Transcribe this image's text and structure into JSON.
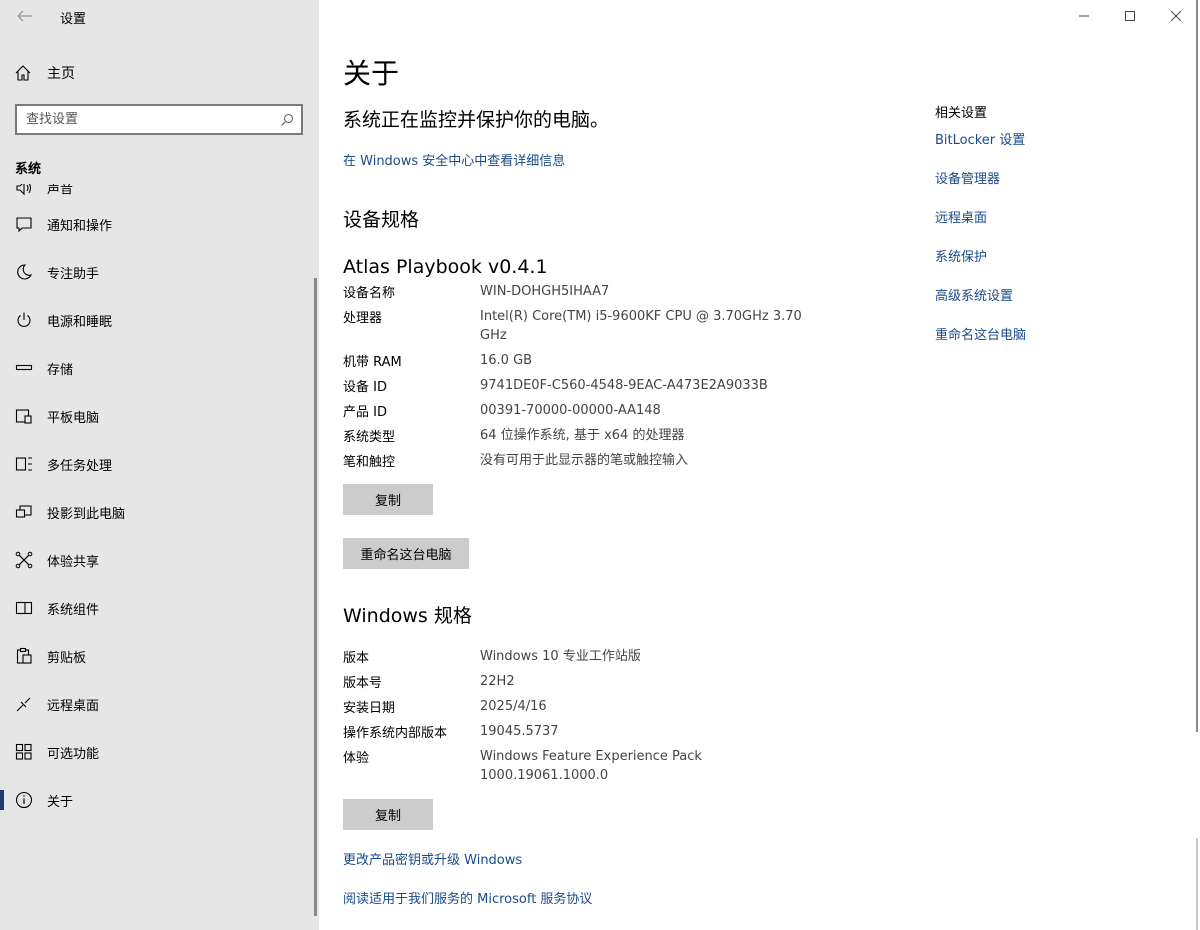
{
  "window": {
    "app_title": "设置",
    "controls": {
      "minimize": "—",
      "maximize": "☐",
      "close": "✕"
    }
  },
  "sidebar": {
    "home_label": "主页",
    "search_placeholder": "查找设置",
    "section_label": "系统",
    "items": [
      {
        "label": "声音",
        "icon": "speaker-icon"
      },
      {
        "label": "通知和操作",
        "icon": "message-icon"
      },
      {
        "label": "专注助手",
        "icon": "moon-icon"
      },
      {
        "label": "电源和睡眠",
        "icon": "power-icon"
      },
      {
        "label": "存储",
        "icon": "storage-icon"
      },
      {
        "label": "平板电脑",
        "icon": "tablet-icon"
      },
      {
        "label": "多任务处理",
        "icon": "multitask-icon"
      },
      {
        "label": "投影到此电脑",
        "icon": "project-icon"
      },
      {
        "label": "体验共享",
        "icon": "share-icon"
      },
      {
        "label": "系统组件",
        "icon": "components-icon"
      },
      {
        "label": "剪贴板",
        "icon": "clipboard-icon"
      },
      {
        "label": "远程桌面",
        "icon": "remote-icon"
      },
      {
        "label": "可选功能",
        "icon": "features-icon"
      },
      {
        "label": "关于",
        "icon": "info-icon",
        "active": true
      }
    ]
  },
  "main": {
    "title": "关于",
    "status": "系统正在监控并保护你的电脑。",
    "security_link": "在 Windows 安全中心中查看详细信息",
    "device_spec_heading": "设备规格",
    "device_name_title": "Atlas Playbook v0.4.1",
    "device_specs": [
      {
        "key": "设备名称",
        "value": "WIN-DOHGH5IHAA7"
      },
      {
        "key": "处理器",
        "value": "Intel(R) Core(TM) i5-9600KF CPU @ 3.70GHz   3.70 GHz"
      },
      {
        "key": "机带 RAM",
        "value": "16.0 GB"
      },
      {
        "key": "设备 ID",
        "value": "9741DE0F-C560-4548-9EAC-A473E2A9033B"
      },
      {
        "key": "产品 ID",
        "value": "00391-70000-00000-AA148"
      },
      {
        "key": "系统类型",
        "value": "64 位操作系统, 基于 x64 的处理器"
      },
      {
        "key": "笔和触控",
        "value": "没有可用于此显示器的笔或触控输入"
      }
    ],
    "copy_button": "复制",
    "rename_button": "重命名这台电脑",
    "windows_spec_heading": "Windows 规格",
    "windows_specs": [
      {
        "key": "版本",
        "value": "Windows 10 专业工作站版"
      },
      {
        "key": "版本号",
        "value": "22H2"
      },
      {
        "key": "安装日期",
        "value": "2025/4/16"
      },
      {
        "key": "操作系统内部版本",
        "value": "19045.5737"
      },
      {
        "key": "体验",
        "value": "Windows Feature Experience Pack 1000.19061.1000.0"
      }
    ],
    "copy_button_2": "复制",
    "product_key_link": "更改产品密钥或升级 Windows",
    "service_link": "阅读适用于我们服务的 Microsoft 服务协议"
  },
  "related": {
    "title": "相关设置",
    "links": [
      "BitLocker 设置",
      "设备管理器",
      "远程桌面",
      "系统保护",
      "高级系统设置",
      "重命名这台电脑"
    ]
  }
}
